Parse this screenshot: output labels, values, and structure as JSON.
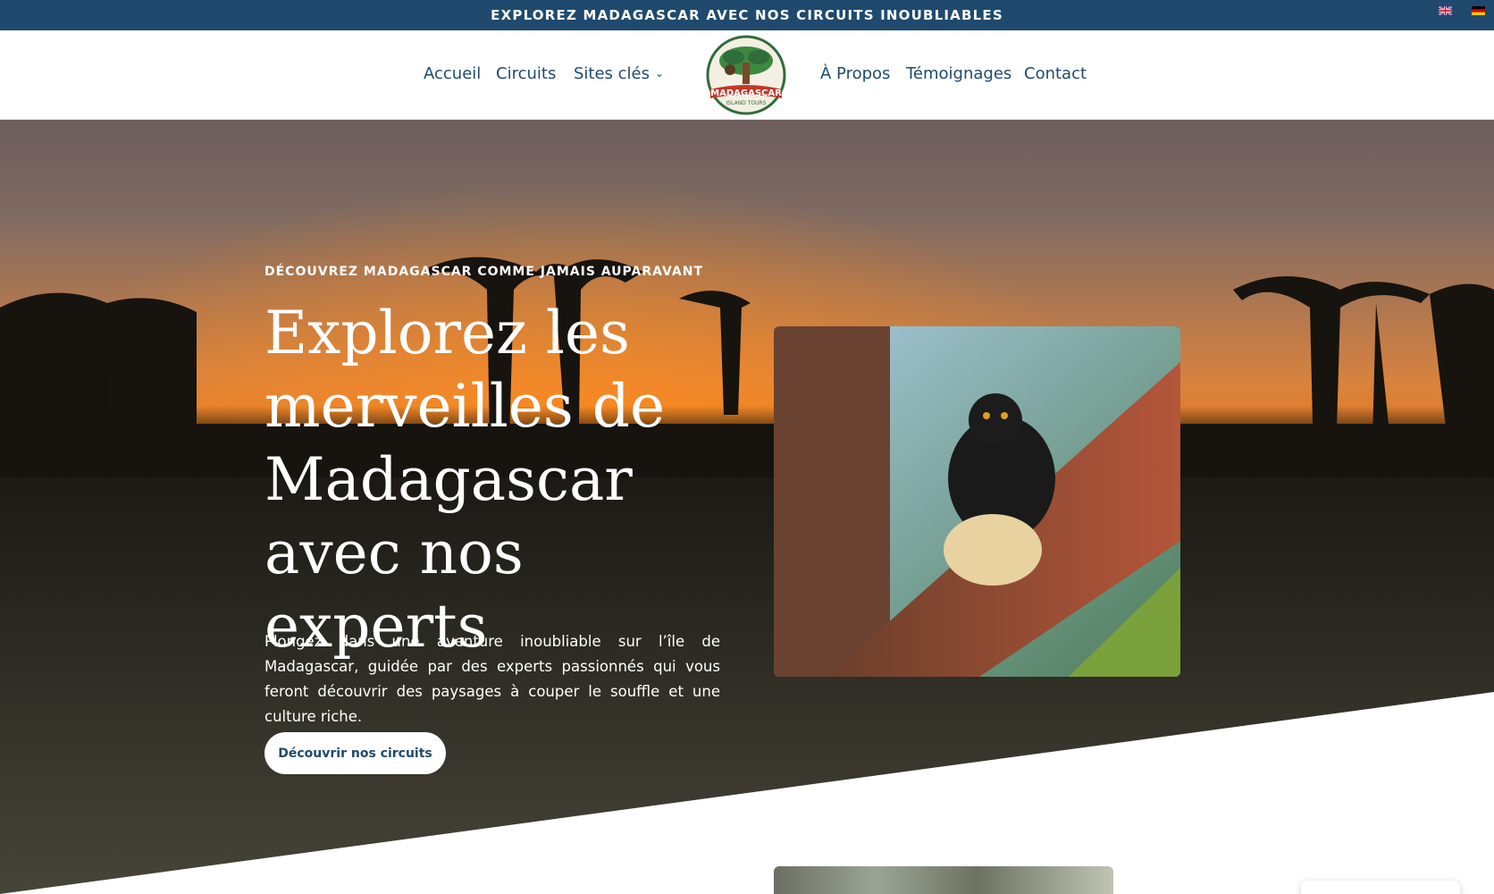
{
  "topbar": {
    "announcement": "EXPLOREZ MADAGASCAR AVEC NOS CIRCUITS INOUBLIABLES",
    "flags": [
      "english-flag",
      "german-flag"
    ]
  },
  "nav": {
    "items": [
      {
        "label": "Accueil"
      },
      {
        "label": "Circuits"
      },
      {
        "label": "Sites clés",
        "has_dropdown": true
      },
      {
        "label": "À Propos"
      },
      {
        "label": "Témoignages"
      },
      {
        "label": "Contact"
      }
    ],
    "logo": {
      "line1": "MADAGASCAR",
      "line2": "ISLAND TOURS"
    }
  },
  "hero": {
    "eyebrow": "DÉCOUVREZ MADAGASCAR COMME JAMAIS AUPARAVANT",
    "title": "Explorez les merveilles de Madagascar avec nos experts",
    "text": "Plongez dans une aventure inoubliable sur l’île de Madagascar, guidée par des experts passionnés qui vous feront découvrir des paysages à couper le souffle et une culture riche.",
    "cta": "Découvrir nos circuits"
  },
  "colors": {
    "brand": "#1f4a6e",
    "sunset": "#e57d23",
    "white": "#ffffff"
  }
}
